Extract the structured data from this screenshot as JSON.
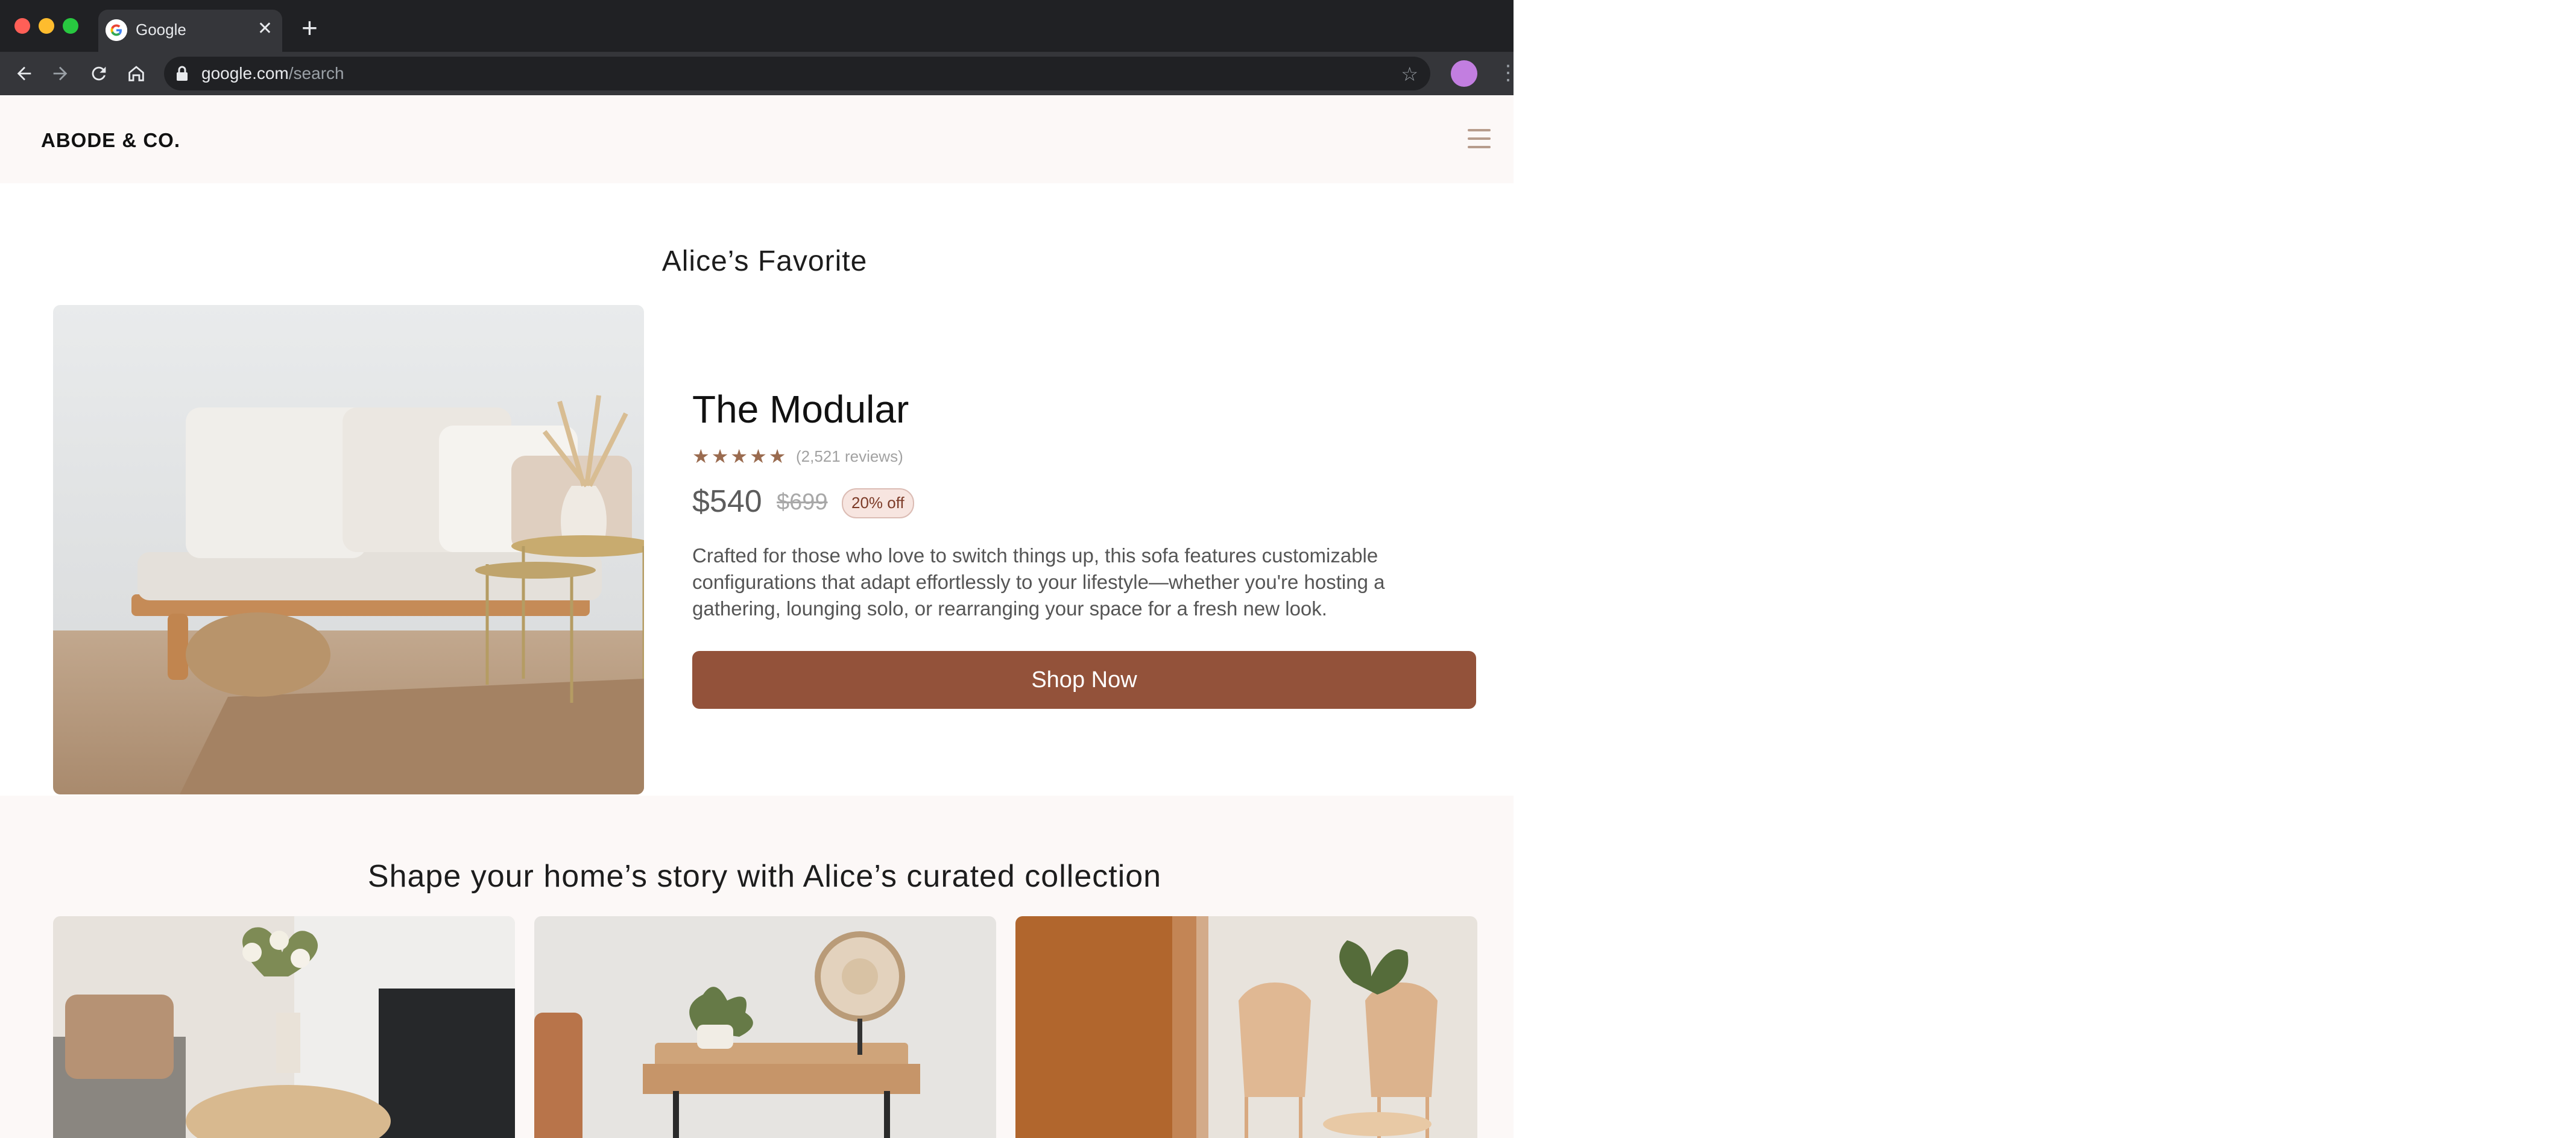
{
  "browser": {
    "tab_title": "Google",
    "url_host": "google.com",
    "url_path": "/search",
    "profile_color": "#c27ee0"
  },
  "site": {
    "brand": "ABODE & CO.",
    "favorite_heading": "Alice’s Favorite",
    "collection_heading": "Shape your home’s story with Alice’s curated collection"
  },
  "product": {
    "name": "The Modular",
    "rating": 5,
    "reviews": "(2,521 reviews)",
    "price": "$540",
    "old_price": "$699",
    "discount": "20% off",
    "description": "Crafted for those who love to switch things up, this sofa features customizable configurations that adapt effortlessly to your lifestyle—whether you're hosting a gathering, lounging solo, or rearranging your space for a fresh new look.",
    "cta": "Shop Now"
  },
  "colors": {
    "accent": "#93523a",
    "star": "#9a6b4f",
    "header_bg": "#fcf8f7"
  },
  "icons": [
    "back-icon",
    "forward-icon",
    "reload-icon",
    "home-icon",
    "lock-icon",
    "bookmark-star-icon",
    "menu-icon",
    "close-icon",
    "new-tab-icon"
  ]
}
